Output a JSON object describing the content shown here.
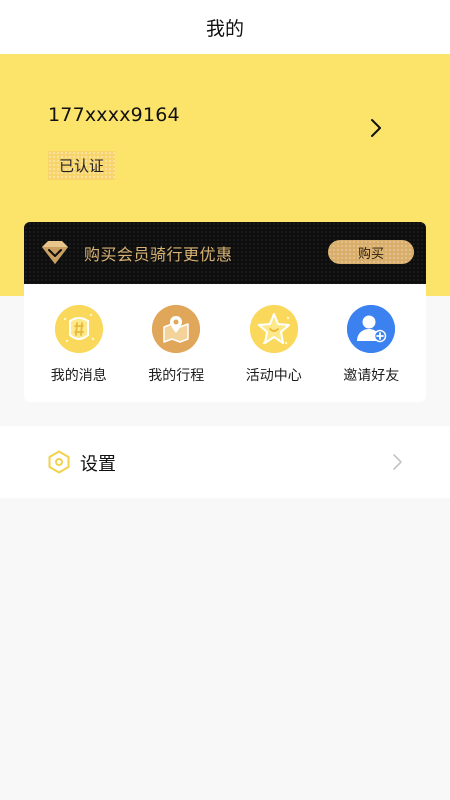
{
  "header": {
    "title": "我的"
  },
  "profile": {
    "phone": "177xxxx9164",
    "verified_badge": "已认证"
  },
  "membership": {
    "promo_text": "购买会员骑行更优惠",
    "buy_label": "购买"
  },
  "quick_actions": [
    {
      "label": "我的消息",
      "icon": "message-icon",
      "color": "#f9d85c"
    },
    {
      "label": "我的行程",
      "icon": "trip-map-icon",
      "color": "#e0a75a"
    },
    {
      "label": "活动中心",
      "icon": "activity-star-icon",
      "color": "#f9d85c"
    },
    {
      "label": "邀请好友",
      "icon": "invite-friend-icon",
      "color": "#3b82f0"
    }
  ],
  "settings": {
    "label": "设置"
  },
  "colors": {
    "accent_yellow": "#fce46a",
    "gold": "#d8b273",
    "dark": "#0e0e0e"
  }
}
